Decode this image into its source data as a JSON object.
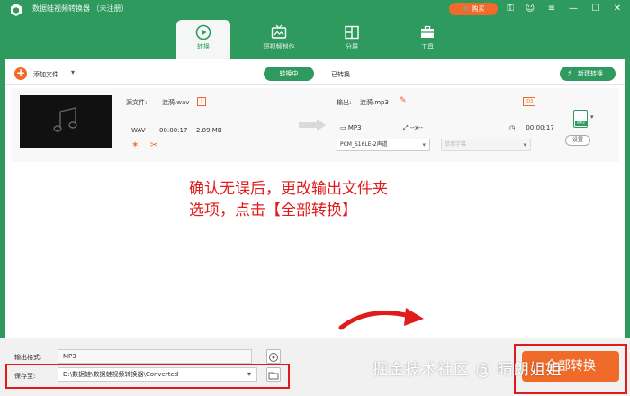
{
  "window": {
    "title": "数据蛙视频转换器 （未注册）",
    "buy_label": "购买"
  },
  "nav": {
    "tabs": [
      {
        "label": "转换",
        "icon": "convert-icon",
        "active": true
      },
      {
        "label": "短视频制作",
        "icon": "tv-icon",
        "active": false
      },
      {
        "label": "分屏",
        "icon": "split-screen-icon",
        "active": false
      },
      {
        "label": "工具",
        "icon": "toolbox-icon",
        "active": false
      }
    ]
  },
  "toolbar": {
    "add_file": "添加文件",
    "tab_converting": "转换中",
    "tab_converted": "已转换",
    "new_task": "新建转换"
  },
  "file": {
    "source_label": "源文件:",
    "source_name": "涟漪.wav",
    "format": "WAV",
    "duration": "00:00:17",
    "size": "2.89 MB",
    "output_label": "输出:",
    "output_name": "涟漪.mp3",
    "output_format": "MP3",
    "output_res": "--x--",
    "output_duration": "00:00:17",
    "audio_track": "PCM_S16LE-2声道",
    "subtitle": "禁用字幕",
    "settings_label": "设置",
    "badge_text": "ID3",
    "mp3_file_text": "MP3"
  },
  "annotation": {
    "line1": "确认无误后，更改输出文件夹",
    "line2": "选项，点击【全部转换】"
  },
  "bottom": {
    "output_format_label": "输出格式:",
    "output_format_value": "MP3",
    "save_to_label": "保存至:",
    "save_to_value": "D:\\数据蛙\\数据蛙视频转换器\\Converted",
    "convert_all": "全部转换"
  },
  "watermark": "掘金技术社区 @ 晴朗姐姐",
  "colors": {
    "brand_green": "#2f9a5e",
    "accent_orange": "#f06a2a",
    "annotation_red": "#e01b1b"
  }
}
